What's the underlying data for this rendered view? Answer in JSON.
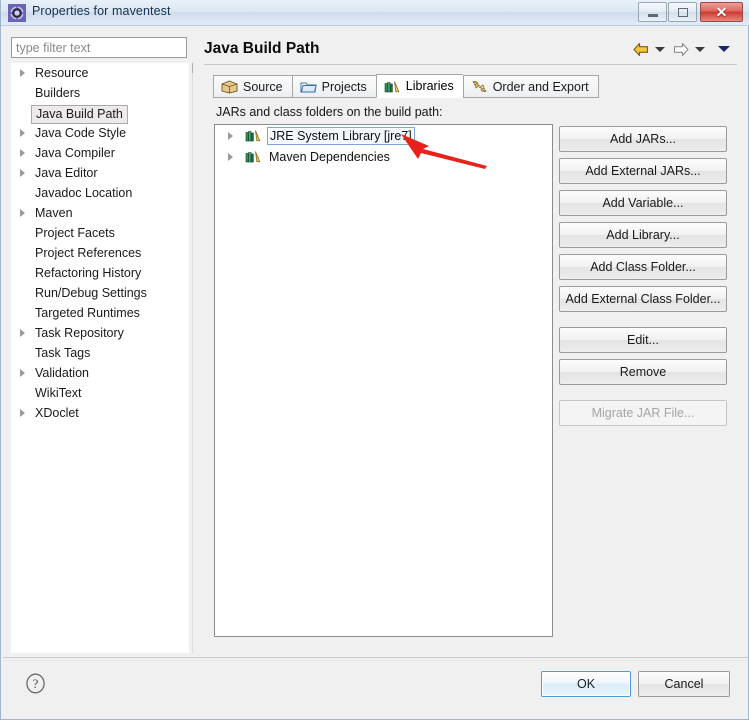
{
  "window": {
    "title": "Properties for maventest",
    "icon": "properties-gear-icon",
    "controls": {
      "minimize": "Minimize",
      "maximize": "Maximize",
      "close": "Close"
    }
  },
  "sidebar": {
    "filter": {
      "placeholder": "type filter text",
      "value": ""
    },
    "items": [
      {
        "label": "Resource",
        "expandable": true,
        "selected": false
      },
      {
        "label": "Builders",
        "expandable": false,
        "selected": false
      },
      {
        "label": "Java Build Path",
        "expandable": false,
        "selected": true
      },
      {
        "label": "Java Code Style",
        "expandable": true,
        "selected": false
      },
      {
        "label": "Java Compiler",
        "expandable": true,
        "selected": false
      },
      {
        "label": "Java Editor",
        "expandable": true,
        "selected": false
      },
      {
        "label": "Javadoc Location",
        "expandable": false,
        "selected": false
      },
      {
        "label": "Maven",
        "expandable": true,
        "selected": false
      },
      {
        "label": "Project Facets",
        "expandable": false,
        "selected": false
      },
      {
        "label": "Project References",
        "expandable": false,
        "selected": false
      },
      {
        "label": "Refactoring History",
        "expandable": false,
        "selected": false
      },
      {
        "label": "Run/Debug Settings",
        "expandable": false,
        "selected": false
      },
      {
        "label": "Targeted Runtimes",
        "expandable": false,
        "selected": false
      },
      {
        "label": "Task Repository",
        "expandable": true,
        "selected": false
      },
      {
        "label": "Task Tags",
        "expandable": false,
        "selected": false
      },
      {
        "label": "Validation",
        "expandable": true,
        "selected": false
      },
      {
        "label": "WikiText",
        "expandable": false,
        "selected": false
      },
      {
        "label": "XDoclet",
        "expandable": true,
        "selected": false
      }
    ]
  },
  "content": {
    "page_title": "Java Build Path",
    "nav": {
      "back_icon": "back-arrow-icon",
      "back_dropdown_icon": "chevron-down-icon",
      "forward_icon": "forward-arrow-icon",
      "forward_dropdown_icon": "chevron-down-icon",
      "menu_icon": "chevron-down-icon"
    },
    "tabs": [
      {
        "label": "Source",
        "icon": "source-package-icon",
        "active": false
      },
      {
        "label": "Projects",
        "icon": "folder-icon",
        "active": false
      },
      {
        "label": "Libraries",
        "icon": "books-icon",
        "active": true
      },
      {
        "label": "Order and Export",
        "icon": "order-arrows-icon",
        "active": false
      }
    ],
    "section_label": "JARs and class folders on the build path:",
    "tree_items": [
      {
        "label": "JRE System Library [jre7]",
        "icon": "library-books-icon",
        "expandable": true,
        "focused": true
      },
      {
        "label": "Maven Dependencies",
        "icon": "library-books-icon",
        "expandable": true,
        "focused": false
      }
    ],
    "annotation": {
      "type": "red-arrow",
      "color": "#e8211a",
      "points_to": "JRE System Library [jre7]"
    },
    "side_buttons": [
      {
        "label": "Add JARs...",
        "enabled": true
      },
      {
        "label": "Add External JARs...",
        "enabled": true
      },
      {
        "label": "Add Variable...",
        "enabled": true
      },
      {
        "label": "Add Library...",
        "enabled": true
      },
      {
        "label": "Add Class Folder...",
        "enabled": true
      },
      {
        "label": "Add External Class Folder...",
        "enabled": true
      },
      {
        "label": "Edit...",
        "enabled": true
      },
      {
        "label": "Remove",
        "enabled": true
      },
      {
        "label": "Migrate JAR File...",
        "enabled": false
      }
    ]
  },
  "footer": {
    "help_icon": "help-question-icon",
    "ok_label": "OK",
    "cancel_label": "Cancel"
  },
  "colors": {
    "accent": "#4a9fd4",
    "title_text": "#12314f",
    "annotation_red": "#e8211a",
    "close_button": "#c93b33"
  }
}
